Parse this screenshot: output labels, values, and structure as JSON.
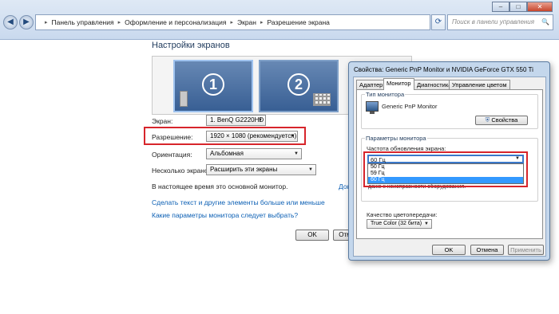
{
  "window": {
    "minimize_glyph": "–",
    "maximize_glyph": "□",
    "close_glyph": "✕"
  },
  "nav": {
    "back_glyph": "◀",
    "forward_glyph": "▶"
  },
  "breadcrumb": {
    "items": [
      "Панель управления",
      "Оформление и персонализация",
      "Экран",
      "Разрешение экрана"
    ],
    "separator": "▸"
  },
  "refresh_glyph": "⟳",
  "search": {
    "placeholder": "Поиск в панели управления",
    "icon_glyph": "🔍"
  },
  "main": {
    "title": "Настройки экранов",
    "monitor1_number": "1",
    "monitor2_number": "2",
    "screen_label": "Экран:",
    "screen_value": "1. BenQ G2220HD",
    "resolution_label": "Разрешение:",
    "resolution_value": "1920 × 1080 (рекомендуется)",
    "orientation_label": "Ориентация:",
    "orientation_value": "Альбомная",
    "multi_label": "Несколько экранов:",
    "multi_value": "Расширить эти экраны",
    "primary_text": "В настоящее время это основной монитор.",
    "partial_link": "Допо",
    "link1": "Сделать текст и другие элементы больше или меньше",
    "link2": "Какие параметры монитора следует выбрать?",
    "ok_label": "OK",
    "cancel_partial": "Отм",
    "dropdown_glyph": "▼"
  },
  "dialog": {
    "title": "Свойства: Generic PnP Monitor и NVIDIA GeForce GTX 550 Ti",
    "detect_button_partial": "",
    "tabs": [
      "Адаптер",
      "Монитор",
      "Диагностика",
      "Управление цветом"
    ],
    "monitor_type_group": "Тип монитора",
    "monitor_name": "Generic PnP Monitor",
    "properties_button": "Свойства",
    "params_group": "Параметры монитора",
    "refresh_label": "Частота обновления экрана:",
    "refresh_value": "60 Гц",
    "refresh_options": [
      "50 Гц",
      "59 Гц",
      "60 Гц"
    ],
    "refresh_selected_index": 2,
    "warning_text": "экрана, не поддерживаемую этим монитором, что может привести к выводу неустойчивого изображения или даже к неисправности оборудования.",
    "color_label": "Качество цветопередачи:",
    "color_value": "True Color (32 бита)",
    "ok_label": "OK",
    "cancel_label": "Отмена",
    "apply_label": "Применить"
  },
  "colors": {
    "highlight_red": "#d7252b",
    "link_blue": "#0b5fb4",
    "selection_blue": "#3399ff"
  }
}
